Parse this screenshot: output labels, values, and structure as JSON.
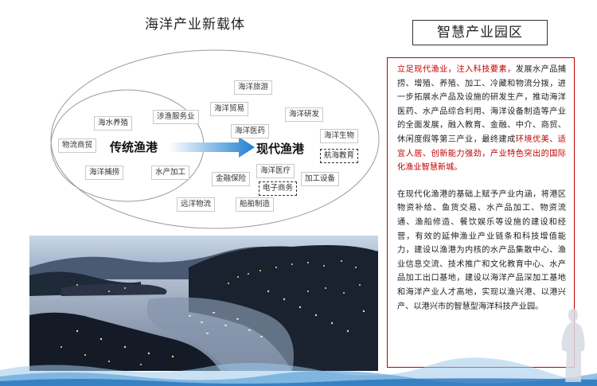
{
  "left_title": "海洋产业新载体",
  "right_title": "智慧产业园区",
  "diagram": {
    "traditional": "传统渔港",
    "modern": "现代渔港",
    "left_tags": [
      "海水养殖",
      "涉渔服务业",
      "物流商贸",
      "海洋捕捞",
      "水产加工"
    ],
    "right_tags": [
      "海洋旅游",
      "海洋贸易",
      "海洋研发",
      "海洋医药",
      "海洋生物",
      "航海教育",
      "海洋医疗",
      "电子商务",
      "金融保险",
      "加工设备",
      "远洋物流",
      "船舶制造"
    ]
  },
  "text": {
    "p1_red": "立足现代渔业，注入科技要素，",
    "p1_body": "发展水产品捕捞、增殖、养殖、加工、冷藏和物流分拨，进一步拓展水产品及设施的研发生产，推动海洋医药、水产品综合利用、海洋设备制造等产业的全面发展，融入教育、金融、中介、商贸、休闲度假等第三产业，最终建成",
    "p1_red2": "环境优美、适宜人居、创新能力强劲，产业特色突出的国际化渔业智慧新城。",
    "p2": "在现代化渔港的基础上赋予产业内涵，将港区物资补给、鱼货交易、水产品加工、物资流通、渔船修造、餐饮娱乐等设施的建设和经营，有效的延伸渔业产业链条和科技增值能力，建设以渔港为内核的水产品集散中心、渔业信息交流、技术推广和文化教育中心、水产品加工出口基地，建设以海洋产品深加工基地和海洋产业人才高地，实现以渔兴港、以港兴产、以港兴市的智慧型海洋科技产业园。"
  }
}
